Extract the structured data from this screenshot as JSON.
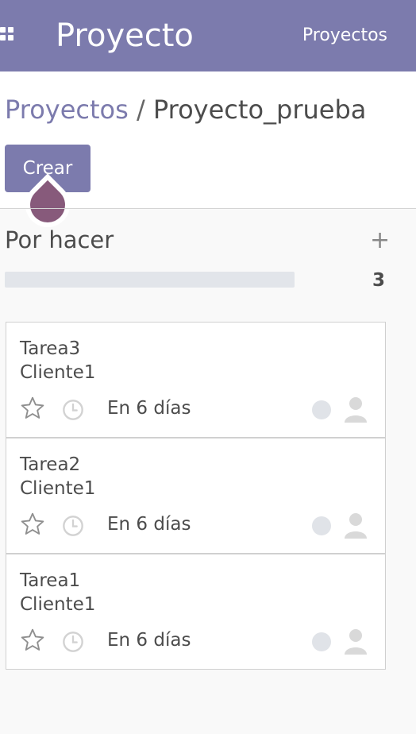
{
  "topbar": {
    "app_title": "Proyecto",
    "nav_link": "Proyectos"
  },
  "breadcrumb": {
    "parent": "Proyectos",
    "separator": "/",
    "current": "Proyecto_prueba"
  },
  "toolbar": {
    "create_label": "Crear"
  },
  "column": {
    "title": "Por hacer",
    "count": "3",
    "progress": 0
  },
  "cards": [
    {
      "name": "Tarea3",
      "client": "Cliente1",
      "deadline": "En 6 días"
    },
    {
      "name": "Tarea2",
      "client": "Cliente1",
      "deadline": "En 6 días"
    },
    {
      "name": "Tarea1",
      "client": "Cliente1",
      "deadline": "En 6 días"
    }
  ],
  "icons": {
    "apps": "apps-grid-icon",
    "add": "plus-icon",
    "star": "star-outline-icon",
    "clock": "clock-icon",
    "status": "status-circle-icon",
    "user": "user-placeholder-icon"
  },
  "colors": {
    "brand": "#7c7bad",
    "accent_drop": "#875a7b",
    "progress_bg": "#e2e5ea"
  }
}
